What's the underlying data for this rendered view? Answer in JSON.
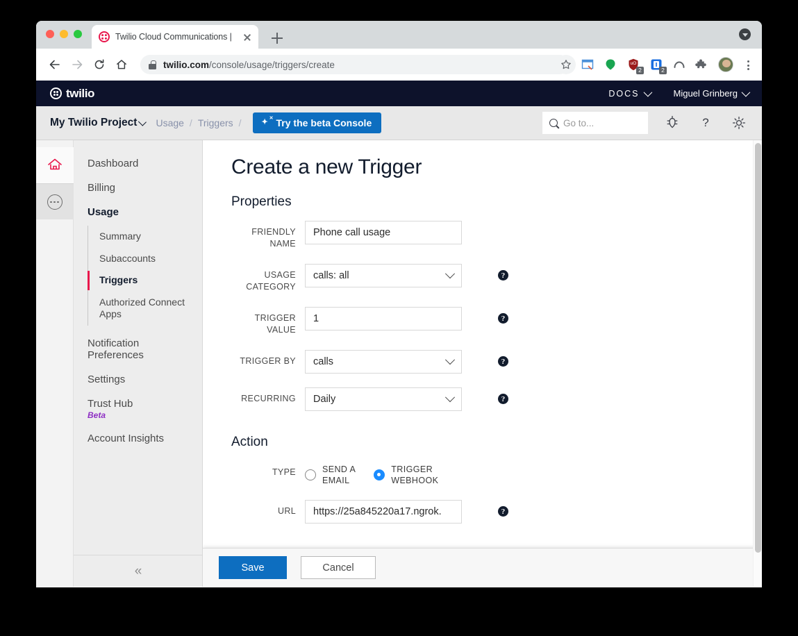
{
  "browser": {
    "tab": {
      "title": "Twilio Cloud Communications |",
      "favicon_name": "twilio-favicon"
    },
    "newtab_label": "+",
    "address": {
      "domain": "twilio.com",
      "path": "/console/usage/triggers/create",
      "full": "twilio.com/console/usage/triggers/create"
    },
    "extensions": [
      {
        "name": "reading-list-icon",
        "badge": ""
      },
      {
        "name": "green-bubble-icon",
        "badge": ""
      },
      {
        "name": "ublock-origin-icon",
        "badge": "2"
      },
      {
        "name": "onepassword-icon",
        "badge": "2"
      },
      {
        "name": "arc-icon",
        "badge": ""
      },
      {
        "name": "extensions-puzzle-icon",
        "badge": ""
      }
    ]
  },
  "twilio_header": {
    "logo_text": "twilio",
    "docs_label": "DOCS",
    "user_label": "Miguel Grinberg"
  },
  "subheader": {
    "project": "My Twilio Project",
    "breadcrumbs": [
      "Usage",
      "Triggers"
    ],
    "separator": "/",
    "beta_button": "Try the beta Console",
    "search_placeholder": "Go to...",
    "icons": [
      "bug-icon",
      "question-mark-icon",
      "gear-icon"
    ]
  },
  "rail": {
    "items": [
      "home-icon",
      "more-dots-icon"
    ]
  },
  "sidebar": {
    "items": [
      {
        "label": "Dashboard",
        "bold": false
      },
      {
        "label": "Billing",
        "bold": false
      },
      {
        "label": "Usage",
        "bold": true
      }
    ],
    "sub_items": [
      {
        "label": "Summary",
        "active": false
      },
      {
        "label": "Subaccounts",
        "active": false
      },
      {
        "label": "Triggers",
        "active": true
      },
      {
        "label": "Authorized Connect Apps",
        "active": false
      }
    ],
    "tail_items": [
      {
        "label": "Notification Preferences",
        "tag": ""
      },
      {
        "label": "Settings",
        "tag": ""
      },
      {
        "label": "Trust Hub",
        "tag": "Beta"
      },
      {
        "label": "Account Insights",
        "tag": ""
      }
    ],
    "collapse_icon": "«"
  },
  "main": {
    "page_title": "Create a new Trigger",
    "properties_title": "Properties",
    "action_title": "Action",
    "fields": [
      {
        "label": "FRIENDLY NAME",
        "type": "text",
        "value": "Phone call usage",
        "help": false
      },
      {
        "label": "USAGE CATEGORY",
        "type": "select",
        "value": "calls: all",
        "help": true
      },
      {
        "label": "TRIGGER VALUE",
        "type": "text",
        "value": "1",
        "help": true
      },
      {
        "label": "TRIGGER BY",
        "type": "select",
        "value": "calls",
        "help": true
      },
      {
        "label": "RECURRING",
        "type": "select",
        "value": "Daily",
        "help": true
      }
    ],
    "type_field": {
      "label": "TYPE",
      "options": [
        {
          "label": "SEND A\nEMAIL",
          "selected": false
        },
        {
          "label": "TRIGGER\nWEBHOOK",
          "selected": true
        }
      ]
    },
    "url_field": {
      "label": "URL",
      "value": "https://25a845220a17.ngrok.",
      "help": true
    },
    "help_glyph": "?"
  },
  "footer": {
    "save_label": "Save",
    "cancel_label": "Cancel"
  },
  "colors": {
    "twilio_red": "#F22F46",
    "header_navy": "#0d122b",
    "accent_blue": "#0d6ec0",
    "radio_blue": "#1a8cff",
    "beta_purple": "#8e2fc4"
  }
}
